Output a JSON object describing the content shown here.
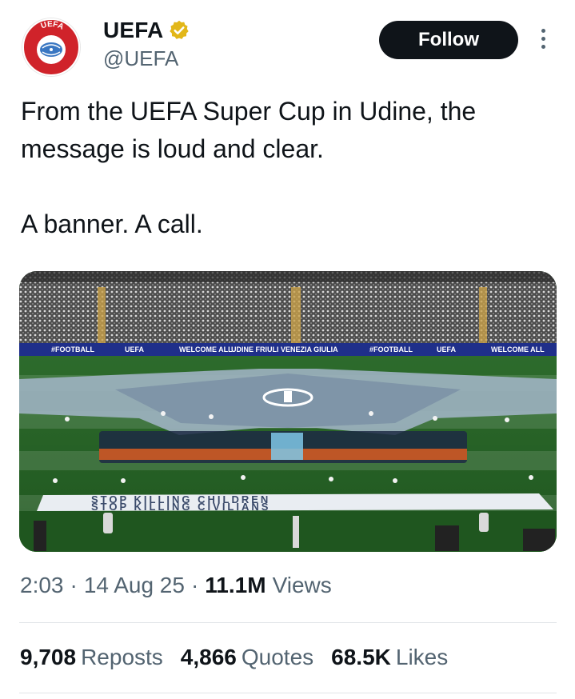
{
  "author": {
    "display_name": "UEFA",
    "handle": "@UEFA",
    "logo_text": "UEFA",
    "verified_color": "#e2b719"
  },
  "follow_label": "Follow",
  "tweet": {
    "line1": "From the UEFA Super Cup in Udine, the message is loud and clear.",
    "line2": "A banner. A call."
  },
  "media": {
    "ad_boards": [
      "#FOOTBALL",
      "UEFA",
      "WELCOME ALL",
      "UDINE FRIULI VENEZIA GIULIA",
      "#FOOTBALL",
      "UEFA",
      "WELCOME ALL"
    ],
    "banner_line1": "STOP KILLING CHILDREN",
    "banner_line2": "STOP KILLING CIVILIANS"
  },
  "meta": {
    "time": "2:03",
    "date": "14 Aug 25",
    "views_count": "11.1M",
    "views_label": "Views"
  },
  "stats": {
    "reposts_count": "9,708",
    "reposts_label": "Reposts",
    "quotes_count": "4,866",
    "quotes_label": "Quotes",
    "likes_count": "68.5K",
    "likes_label": "Likes"
  },
  "colors": {
    "follow_bg": "#0f1419",
    "secondary_text": "#536471",
    "pitch": "#2f7a2f",
    "logo_red": "#d0232a"
  }
}
